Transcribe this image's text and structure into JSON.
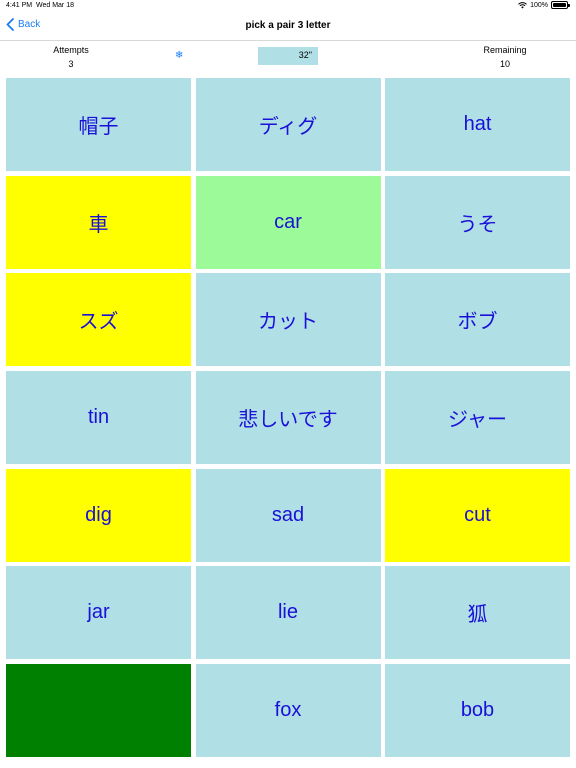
{
  "status": {
    "time": "4:41 PM",
    "date": "Wed Mar 18",
    "battery": "100%"
  },
  "nav": {
    "back_label": "Back",
    "title": "pick a pair 3 letter"
  },
  "stats": {
    "attempts_label": "Attempts",
    "attempts_value": "3",
    "timer": "32\"",
    "remaining_label": "Remaining",
    "remaining_value": "10"
  },
  "colors": {
    "default": "#b0dfe5",
    "selected": "#ffff00",
    "matched_hint": "#9cfb98",
    "matched": "#008000",
    "text": "#1a10d8"
  },
  "cards": [
    {
      "text": "帽子",
      "state": "default"
    },
    {
      "text": "ディグ",
      "state": "default"
    },
    {
      "text": "hat",
      "state": "default"
    },
    {
      "text": "車",
      "state": "selected"
    },
    {
      "text": "car",
      "state": "matched_hint"
    },
    {
      "text": "うそ",
      "state": "default"
    },
    {
      "text": "スズ",
      "state": "selected"
    },
    {
      "text": "カット",
      "state": "default"
    },
    {
      "text": "ボブ",
      "state": "default"
    },
    {
      "text": "tin",
      "state": "default"
    },
    {
      "text": "悲しいです",
      "state": "default"
    },
    {
      "text": "ジャー",
      "state": "default"
    },
    {
      "text": "dig",
      "state": "selected"
    },
    {
      "text": "sad",
      "state": "default"
    },
    {
      "text": "cut",
      "state": "selected"
    },
    {
      "text": "jar",
      "state": "default"
    },
    {
      "text": "lie",
      "state": "default"
    },
    {
      "text": "狐",
      "state": "default"
    },
    {
      "text": "",
      "state": "matched"
    },
    {
      "text": "fox",
      "state": "default"
    },
    {
      "text": "bob",
      "state": "default"
    }
  ]
}
